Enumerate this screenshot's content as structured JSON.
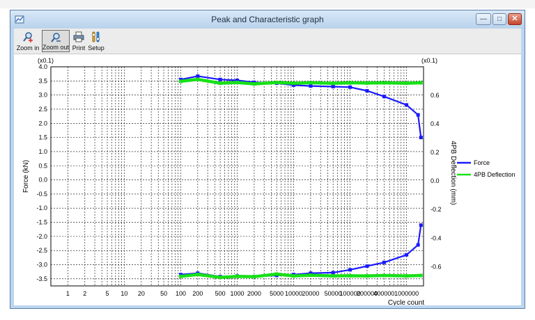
{
  "window": {
    "title": "Peak and Characteristic graph"
  },
  "toolbar": {
    "zoom_in": "Zoom in",
    "zoom_out": "Zoom out",
    "print": "Print",
    "setup": "Setup"
  },
  "icons": {
    "app": "graph-app-icon",
    "zoom_in": "zoom-in-icon",
    "zoom_out": "zoom-out-icon",
    "print": "printer-icon",
    "setup": "setup-icon"
  },
  "colors": {
    "force": "#1a1aff",
    "deflection": "#18e018",
    "titlebar": "#bcd6f0",
    "close_button": "#c5452c"
  },
  "chart_data": {
    "type": "line",
    "x_scale": "log",
    "xlabel": "Cycle count",
    "x_ticks": [
      1,
      2,
      5,
      10,
      20,
      50,
      100,
      200,
      500,
      1000,
      2000,
      5000,
      10000,
      20000,
      50000,
      100000,
      200000,
      400000,
      1000000
    ],
    "y_left": {
      "label": "Force (kN)",
      "multiplier": "(x0.1)",
      "range": [
        -3.75,
        4.0
      ],
      "ticks": [
        "4.0",
        "3.5",
        "3.0",
        "2.5",
        "2.0",
        "1.5",
        "1.0",
        "0.5",
        "0.0",
        "-0.5",
        "-1.0",
        "-1.5",
        "-2.0",
        "-2.5",
        "-3.0",
        "-3.5"
      ],
      "tick_values": [
        4.0,
        3.5,
        3.0,
        2.5,
        2.0,
        1.5,
        1.0,
        0.5,
        0.0,
        -0.5,
        -1.0,
        -1.5,
        -2.0,
        -2.5,
        -3.0,
        -3.5
      ]
    },
    "y_right": {
      "label": "4PB Deflection (mm)",
      "multiplier": "(x0.1)",
      "range": [
        -0.735,
        0.8
      ],
      "ticks": [
        "0.6",
        "0.4",
        "0.2",
        "0.0",
        "-0.2",
        "-0.4",
        "-0.6"
      ],
      "tick_values": [
        0.6,
        0.4,
        0.2,
        0.0,
        -0.2,
        -0.4,
        -0.6
      ]
    },
    "grid": true,
    "legend_position": "right",
    "series": [
      {
        "name": "Force",
        "axis": "left",
        "color": "#1a1aff",
        "upper": [
          [
            100,
            3.55
          ],
          [
            200,
            3.67
          ],
          [
            500,
            3.55
          ],
          [
            1000,
            3.52
          ],
          [
            2000,
            3.45
          ],
          [
            5000,
            3.42
          ],
          [
            10000,
            3.35
          ],
          [
            20000,
            3.32
          ],
          [
            50000,
            3.3
          ],
          [
            100000,
            3.28
          ],
          [
            200000,
            3.15
          ],
          [
            400000,
            2.95
          ],
          [
            1000000,
            2.65
          ],
          [
            1600000,
            2.3
          ],
          [
            1800000,
            1.5
          ]
        ],
        "lower": [
          [
            100,
            -3.35
          ],
          [
            200,
            -3.3
          ],
          [
            500,
            -3.42
          ],
          [
            1000,
            -3.4
          ],
          [
            2000,
            -3.42
          ],
          [
            5000,
            -3.38
          ],
          [
            10000,
            -3.35
          ],
          [
            20000,
            -3.3
          ],
          [
            50000,
            -3.28
          ],
          [
            100000,
            -3.18
          ],
          [
            200000,
            -3.05
          ],
          [
            400000,
            -2.92
          ],
          [
            1000000,
            -2.65
          ],
          [
            1600000,
            -2.3
          ],
          [
            1800000,
            -1.6
          ]
        ]
      },
      {
        "name": "4PB Deflection",
        "axis": "right",
        "color": "#18e018",
        "upper": [
          [
            100,
            0.698
          ],
          [
            200,
            0.712
          ],
          [
            500,
            0.685
          ],
          [
            1000,
            0.69
          ],
          [
            2000,
            0.68
          ],
          [
            5000,
            0.69
          ],
          [
            10000,
            0.685
          ],
          [
            20000,
            0.688
          ],
          [
            50000,
            0.684
          ],
          [
            100000,
            0.688
          ],
          [
            200000,
            0.686
          ],
          [
            400000,
            0.688
          ],
          [
            1000000,
            0.685
          ],
          [
            1800000,
            0.688
          ]
        ],
        "lower": [
          [
            100,
            -0.668
          ],
          [
            200,
            -0.655
          ],
          [
            500,
            -0.675
          ],
          [
            1000,
            -0.668
          ],
          [
            2000,
            -0.67
          ],
          [
            5000,
            -0.652
          ],
          [
            10000,
            -0.665
          ],
          [
            20000,
            -0.66
          ],
          [
            50000,
            -0.665
          ],
          [
            100000,
            -0.664
          ],
          [
            200000,
            -0.665
          ],
          [
            400000,
            -0.662
          ],
          [
            1000000,
            -0.665
          ],
          [
            1800000,
            -0.662
          ]
        ]
      }
    ]
  }
}
